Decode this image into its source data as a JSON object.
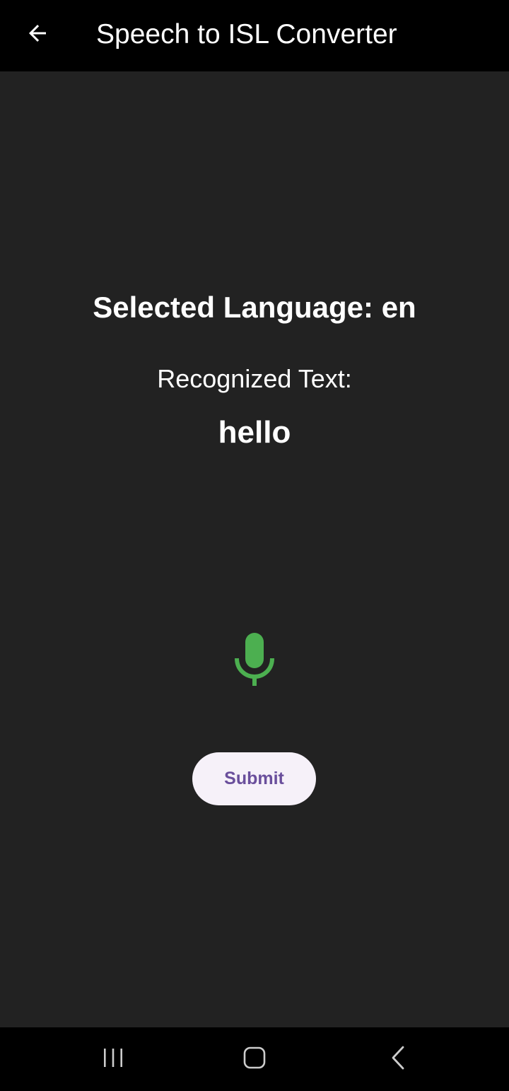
{
  "app_bar": {
    "title": "Speech to ISL Converter",
    "back_icon": "arrow-back-icon"
  },
  "main": {
    "selected_language": "Selected Language: en",
    "recognized_label": "Recognized Text:",
    "recognized_text": "hello",
    "mic_icon": "microphone-icon",
    "submit_label": "Submit"
  },
  "system_nav": {
    "recents_icon": "recents-icon",
    "home_icon": "home-icon",
    "back_icon": "system-back-icon"
  },
  "colors": {
    "app_bar_bg": "#000000",
    "body_bg": "#222222",
    "mic_green": "#4caf50",
    "submit_bg": "#f6f1f9",
    "submit_text": "#6a4f9c"
  }
}
